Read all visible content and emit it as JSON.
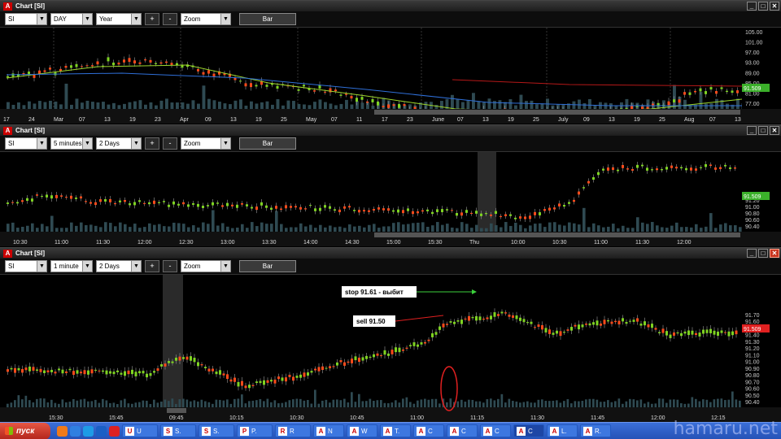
{
  "app": {
    "logo_letter": "A"
  },
  "window_buttons": {
    "minimize": "_",
    "maximize": "□",
    "close": "✕"
  },
  "panels": [
    {
      "title": "Chart [SI]",
      "symbol": "SI",
      "interval": "DAY",
      "range": "Year",
      "plus": "+",
      "minus": "-",
      "zoom": "Zoom",
      "style_button": "Bar",
      "price_badge": "91.509",
      "badge_color": "#3bb02a",
      "y_ticks": [
        "105.00",
        "101.00",
        "97.00",
        "93.00",
        "89.00",
        "85.00",
        "81.00",
        "77.00"
      ],
      "x_ticks": [
        "17",
        "24",
        "Mar",
        "07",
        "13",
        "19",
        "23",
        "Apr",
        "09",
        "13",
        "19",
        "25",
        "May",
        "07",
        "11",
        "17",
        "23",
        "June",
        "07",
        "13",
        "19",
        "25",
        "July",
        "09",
        "13",
        "19",
        "25",
        "Aug",
        "07",
        "13"
      ]
    },
    {
      "title": "Chart [SI]",
      "symbol": "SI",
      "interval": "5 minutes",
      "range": "2 Days",
      "plus": "+",
      "minus": "-",
      "zoom": "Zoom",
      "style_button": "Bar",
      "price_badge": "91.509",
      "badge_color": "#3bb02a",
      "y_ticks": [
        "91.70",
        "91.20",
        "91.00",
        "90.80",
        "90.60",
        "90.40"
      ],
      "x_ticks": [
        "10:30",
        "11:00",
        "11:30",
        "12:00",
        "12:30",
        "13:00",
        "13:30",
        "14:00",
        "14:30",
        "15:00",
        "15:30",
        "Thu",
        "10:00",
        "10:30",
        "11:00",
        "11:30",
        "12:00"
      ]
    },
    {
      "title": "Chart [SI]",
      "symbol": "SI",
      "interval": "1 minute",
      "range": "2 Days",
      "plus": "+",
      "minus": "-",
      "zoom": "Zoom",
      "style_button": "Bar",
      "price_badge": "91.509",
      "badge_color": "#e02020",
      "y_ticks": [
        "91.70",
        "91.60",
        "91.50",
        "91.40",
        "91.30",
        "91.20",
        "91.10",
        "91.00",
        "90.90",
        "90.80",
        "90.70",
        "90.60",
        "90.50",
        "90.40"
      ],
      "x_ticks": [
        "15:30",
        "15:45",
        "09:45",
        "10:15",
        "10:30",
        "10:45",
        "11:00",
        "11:15",
        "11:30",
        "11:45",
        "12:00",
        "12:15"
      ],
      "annotations": {
        "stop": "stop 91.61 - выбит",
        "sell": "sell 91.50"
      }
    }
  ],
  "taskbar": {
    "start_label": "пуск",
    "tasks": [
      {
        "icon": "U",
        "label": "U"
      },
      {
        "icon": "S",
        "label": "S."
      },
      {
        "icon": "S",
        "label": "S."
      },
      {
        "icon": "P",
        "label": "P."
      },
      {
        "icon": "R",
        "label": "R"
      },
      {
        "icon": "A",
        "label": "N"
      },
      {
        "icon": "A",
        "label": "W"
      },
      {
        "icon": "A",
        "label": "T."
      },
      {
        "icon": "A",
        "label": "C"
      },
      {
        "icon": "A",
        "label": "C"
      },
      {
        "icon": "A",
        "label": "C"
      },
      {
        "icon": "A",
        "label": "C"
      },
      {
        "icon": "A",
        "label": "L."
      },
      {
        "icon": "A",
        "label": "R."
      }
    ],
    "watermark": "hamaru.net"
  }
}
